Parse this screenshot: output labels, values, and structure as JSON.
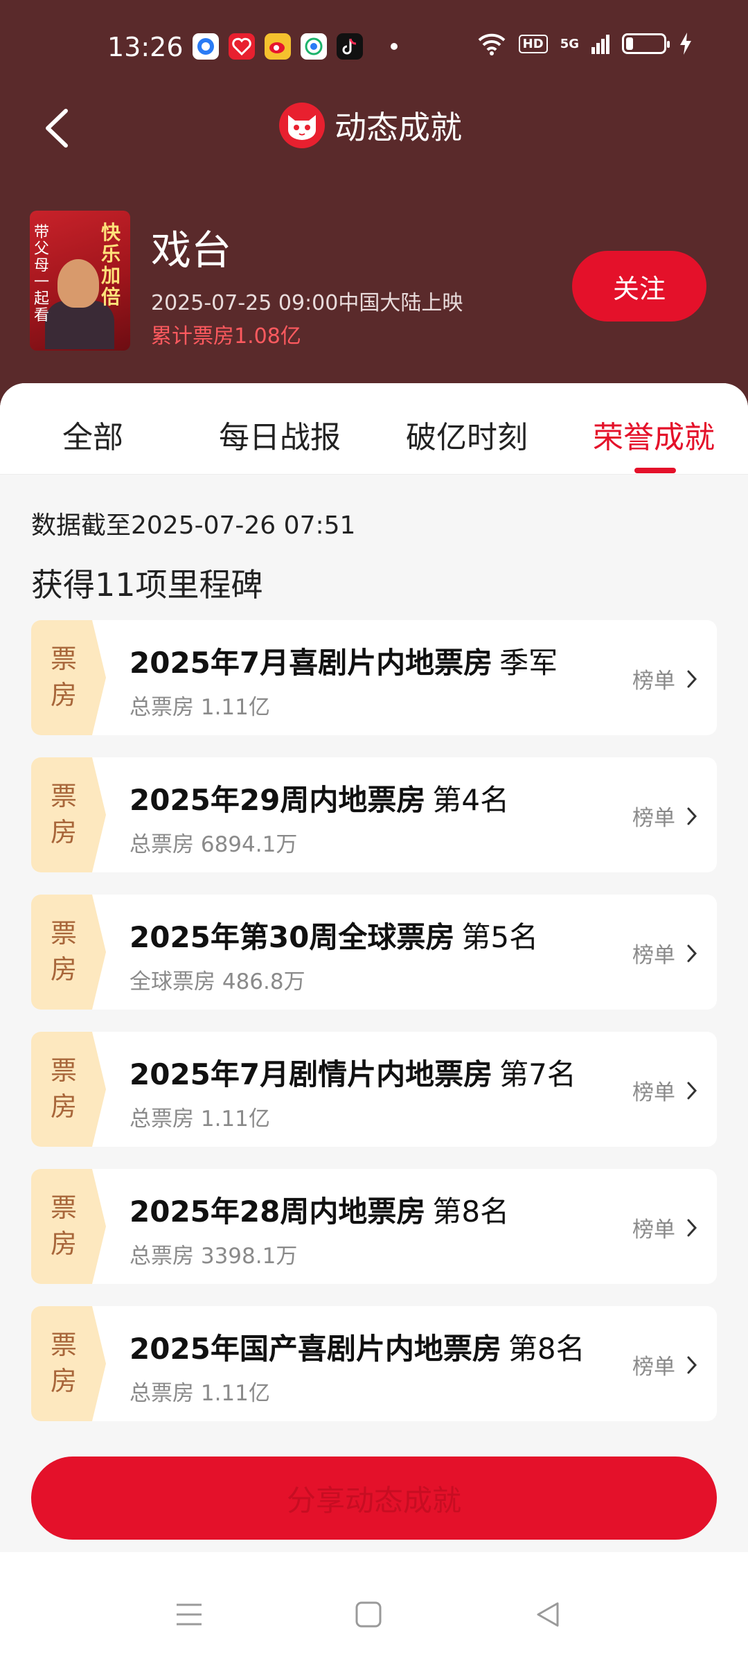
{
  "status_bar": {
    "time": "13:26",
    "network_label": "5G",
    "hd_label": "HD",
    "battery_level_percent": 20,
    "app_icons": [
      "browser-icon",
      "heart-app-icon",
      "weibo-icon",
      "mobile-app-icon",
      "tiktok-icon"
    ]
  },
  "nav": {
    "title": "动态成就"
  },
  "movie": {
    "poster_text_right": "快乐加倍",
    "poster_text_left": "带父母一起看",
    "title": "戏台",
    "release": "2025-07-25 09:00中国大陆上映",
    "box_office": "累计票房1.08亿",
    "follow_label": "关注"
  },
  "tabs": [
    {
      "label": "全部"
    },
    {
      "label": "每日战报"
    },
    {
      "label": "破亿时刻"
    },
    {
      "label": "荣誉成就"
    }
  ],
  "active_tab": "荣誉成就",
  "updated_text": "数据截至2025-07-26  07:51",
  "milestones_count_text": "获得11项里程碑",
  "items": [
    {
      "tag": "票房",
      "title": "2025年7月喜剧片内地票房",
      "rank": "季军",
      "sub": "总票房 1.11亿",
      "link": "榜单"
    },
    {
      "tag": "票房",
      "title": "2025年29周内地票房",
      "rank": "第4名",
      "sub": "总票房 6894.1万",
      "link": "榜单"
    },
    {
      "tag": "票房",
      "title": "2025年第30周全球票房",
      "rank": "第5名",
      "sub": "全球票房 486.8万",
      "link": "榜单"
    },
    {
      "tag": "票房",
      "title": "2025年7月剧情片内地票房",
      "rank": "第7名",
      "sub": "总票房 1.11亿",
      "link": "榜单"
    },
    {
      "tag": "票房",
      "title": "2025年28周内地票房",
      "rank": "第8名",
      "sub": "总票房 3398.1万",
      "link": "榜单"
    },
    {
      "tag": "票房",
      "title": "2025年国产喜剧片内地票房",
      "rank": "第8名",
      "sub": "总票房 1.11亿",
      "link": "榜单"
    }
  ],
  "cta_label": "分享动态成就",
  "colors": {
    "header_bg": "#5a2a2b",
    "accent": "#e4112a",
    "tag_bg": "#fde8bf",
    "tag_text": "#a8663a"
  }
}
